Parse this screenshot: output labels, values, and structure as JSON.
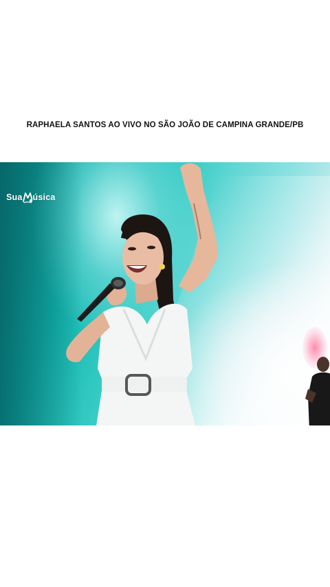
{
  "video": {
    "title": "RAPHAELA SANTOS AO VIVO NO SÃO JOÃO DE CAMPINA GRANDE/PB",
    "watermark": {
      "text_left": "Sua",
      "text_right": "úsica",
      "icon": "music-note-m-icon"
    }
  },
  "colors": {
    "background": "#ffffff",
    "title_text": "#111111",
    "stage_teal": "#11b5ae",
    "stage_light": "#eef3f6",
    "dress_white": "#f4f6f5",
    "hair": "#1c1512"
  }
}
